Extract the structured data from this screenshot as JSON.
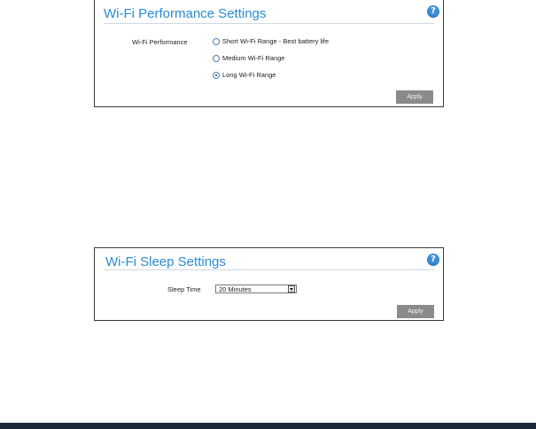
{
  "wifi_performance": {
    "title": "Wi-Fi Performance Settings",
    "help_icon": "?",
    "field_label": "Wi-Fi Performance",
    "options": [
      {
        "label": "Short Wi-Fi Range - Best battery life",
        "checked": false
      },
      {
        "label": "Medium Wi-Fi Range",
        "checked": false
      },
      {
        "label": "Long Wi-Fi Range",
        "checked": true
      }
    ],
    "apply_label": "Apply"
  },
  "wifi_sleep": {
    "title": "Wi-Fi Sleep Settings",
    "help_icon": "?",
    "field_label": "Sleep Time",
    "selected_value": "20 Minutes",
    "apply_label": "Apply"
  },
  "colors": {
    "title_blue": "#2a8bd0",
    "help_blue": "#3d8fd8",
    "button_gray": "#8a8a8a",
    "footer_navy": "#1b2838"
  }
}
